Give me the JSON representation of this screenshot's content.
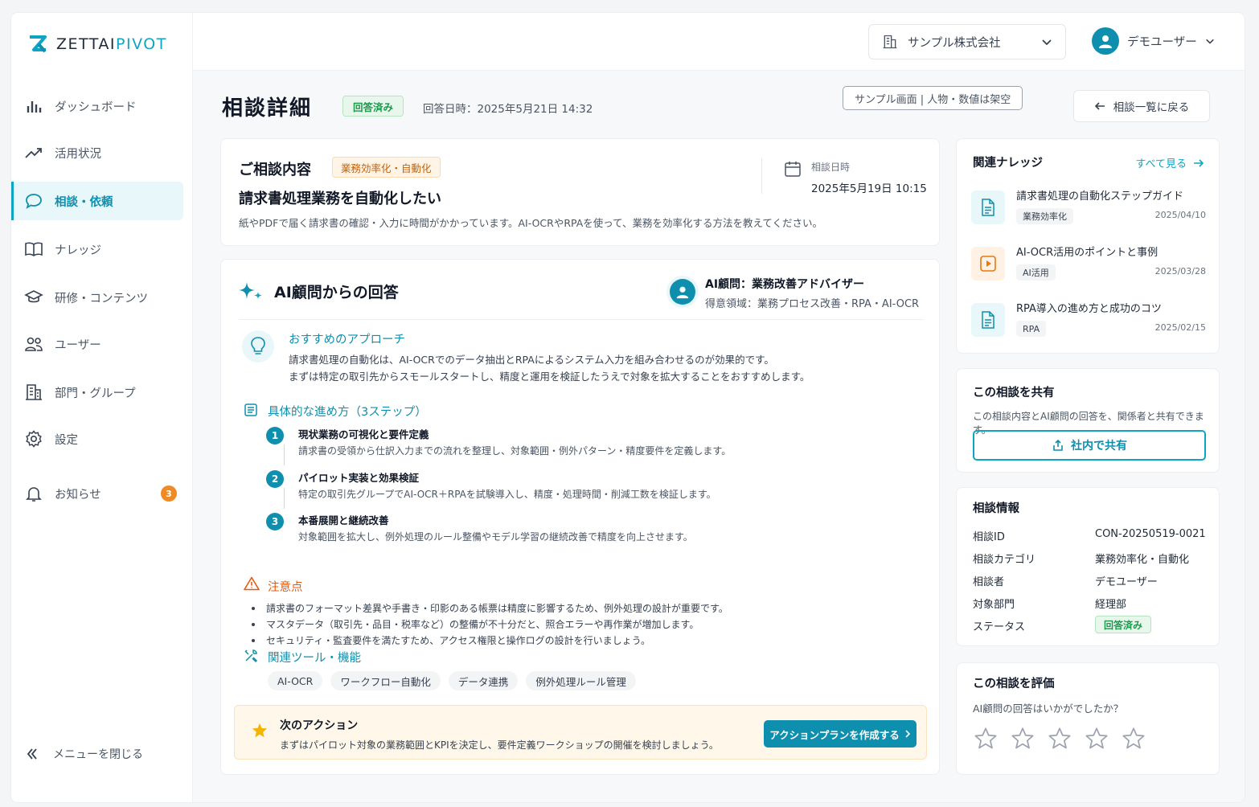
{
  "brand": {
    "name_part1": "ZETTAI",
    "name_part2": "PIVOT",
    "accent": "#0ea5c4"
  },
  "sidebar": {
    "items": [
      {
        "label": "ダッシュボード",
        "icon": "bar-chart-icon"
      },
      {
        "label": "活用状況",
        "icon": "trend-icon"
      },
      {
        "label": "相談・依頼",
        "icon": "chat-icon",
        "active": true
      },
      {
        "label": "ナレッジ",
        "icon": "book-icon"
      },
      {
        "label": "研修・コンテンツ",
        "icon": "graduation-cap-icon"
      },
      {
        "label": "ユーザー",
        "icon": "users-icon"
      },
      {
        "label": "部門・グループ",
        "icon": "building-icon"
      },
      {
        "label": "設定",
        "icon": "gear-icon"
      },
      {
        "label": "お知らせ",
        "icon": "bell-icon",
        "badge": "3"
      }
    ],
    "collapse_label": "メニューを閉じる"
  },
  "topbar": {
    "company": "サンプル株式会社",
    "user": "デモユーザー"
  },
  "header": {
    "title": "相談詳細",
    "status": "回答済み",
    "answered_at": "回答日時：2025年5月21日 14:32",
    "sample_note": "サンプル画面 | 人物・数値は架空",
    "back_label": "相談一覧に戻る"
  },
  "inquiry": {
    "section_title": "ご相談内容",
    "category": "業務効率化・自動化",
    "headline": "請求書処理業務を自動化したい",
    "body": "紙やPDFで届く請求書の確認・入力に時間がかかっています。AI-OCRやRPAを使って、業務を効率化する方法を教えてください。",
    "date_label": "相談日時",
    "date": "2025年5月19日 10:15"
  },
  "answer": {
    "title": "AI顧問からの回答",
    "advisor_name": "AI顧問：業務改善アドバイザー",
    "advisor_field": "得意領域：業務プロセス改善・RPA・AI-OCR",
    "approach_title": "おすすめのアプローチ",
    "approach_line1": "請求書処理の自動化は、AI-OCRでのデータ抽出とRPAによるシステム入力を組み合わせるのが効果的です。",
    "approach_line2": "まずは特定の取引先からスモールスタートし、精度と運用を検証したうえで対象を拡大することをおすすめします。",
    "steps_title": "具体的な進め方（3ステップ）",
    "steps": [
      {
        "num": "1",
        "title": "現状業務の可視化と要件定義",
        "desc": "請求書の受領から仕訳入力までの流れを整理し、対象範囲・例外パターン・精度要件を定義します。"
      },
      {
        "num": "2",
        "title": "パイロット実装と効果検証",
        "desc": "特定の取引先グループでAI-OCR＋RPAを試験導入し、精度・処理時間・削減工数を検証します。"
      },
      {
        "num": "3",
        "title": "本番展開と継続改善",
        "desc": "対象範囲を拡大し、例外処理のルール整備やモデル学習の継続改善で精度を向上させます。"
      }
    ],
    "caution_title": "注意点",
    "cautions": [
      "請求書のフォーマット差異や手書き・印影のある帳票は精度に影響するため、例外処理の設計が重要です。",
      "マスタデータ（取引先・品目・税率など）の整備が不十分だと、照合エラーや再作業が増加します。",
      "セキュリティ・監査要件を満たすため、アクセス権限と操作ログの設計を行いましょう。"
    ],
    "tools_title": "関連ツール・機能",
    "tools": [
      "AI-OCR",
      "ワークフロー自動化",
      "データ連携",
      "例外処理ルール管理"
    ],
    "next_title": "次のアクション",
    "next_desc": "まずはパイロット対象の業務範囲とKPIを決定し、要件定義ワークショップの開催を検討しましょう。",
    "action_label": "アクションプランを作成する"
  },
  "knowledge": {
    "title": "関連ナレッジ",
    "see_all": "すべて見る",
    "items": [
      {
        "title": "請求書処理の自動化ステップガイド",
        "tag": "業務効率化",
        "date": "2025/04/10",
        "icon": "document-icon"
      },
      {
        "title": "AI-OCR活用のポイントと事例",
        "tag": "AI活用",
        "date": "2025/03/28",
        "icon": "video-icon"
      },
      {
        "title": "RPA導入の進め方と成功のコツ",
        "tag": "RPA",
        "date": "2025/02/15",
        "icon": "document-icon"
      }
    ]
  },
  "share": {
    "title": "この相談を共有",
    "desc": "この相談内容とAI顧問の回答を、関係者と共有できます。",
    "button": "社内で共有"
  },
  "info": {
    "title": "相談情報",
    "rows": [
      {
        "label": "相談ID",
        "value": "CON-20250519-0021"
      },
      {
        "label": "相談カテゴリ",
        "value": "業務効率化・自動化"
      },
      {
        "label": "相談者",
        "value": "デモユーザー"
      },
      {
        "label": "対象部門",
        "value": "経理部"
      },
      {
        "label": "ステータス",
        "value": "回答済み"
      }
    ]
  },
  "rating": {
    "title": "この相談を評価",
    "question": "AI顧問の回答はいかがでしたか？",
    "max_stars": 5,
    "selected": 0
  }
}
